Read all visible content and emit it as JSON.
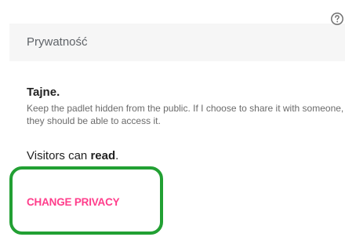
{
  "header": {
    "title": "Prywatność",
    "help_icon": "help-circle-icon"
  },
  "privacy": {
    "title_main": "Tajne",
    "title_suffix": ".",
    "description": "Keep the padlet hidden from the public. If I choose to share it with someone, they should be able to access it.",
    "visitors_prefix": "Visitors can ",
    "visitors_level": "read",
    "visitors_suffix": "."
  },
  "actions": {
    "change_privacy_label": "CHANGE PRIVACY"
  },
  "colors": {
    "accent": "#ff3d8b",
    "highlight_border": "#22a033",
    "header_bg": "#f6f6f6"
  }
}
